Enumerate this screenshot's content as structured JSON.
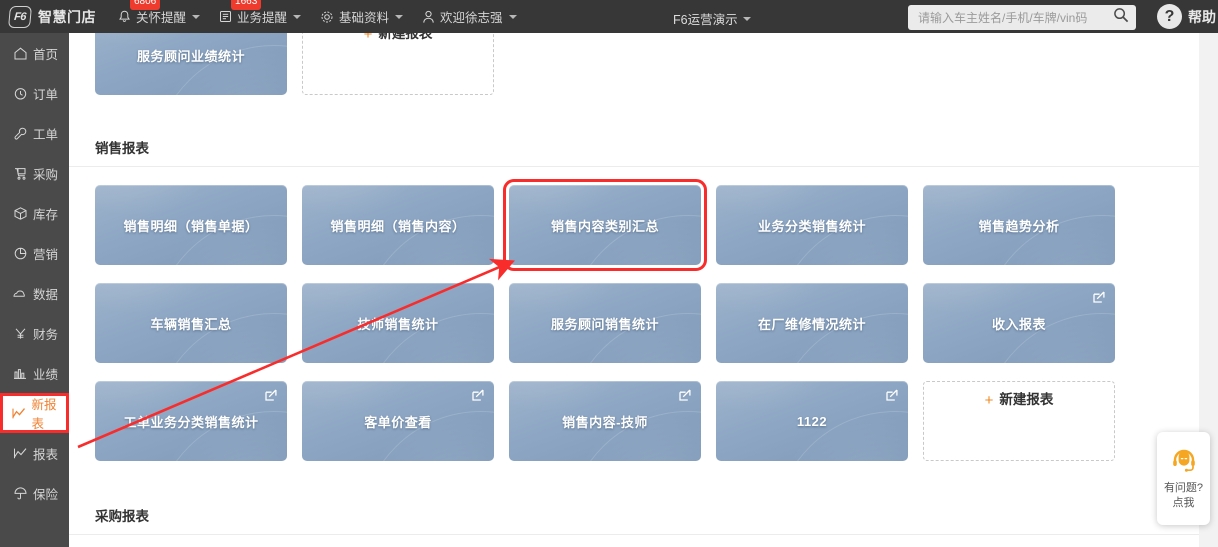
{
  "topbar": {
    "logo_text": "智慧门店",
    "logo_mark": "F6",
    "nav_items": [
      {
        "label": "关怀提醒",
        "icon": "bell-icon",
        "badge": "6806",
        "caret": true
      },
      {
        "label": "业务提醒",
        "icon": "document-icon",
        "badge": "1663",
        "caret": true
      },
      {
        "label": "基础资料",
        "icon": "gear-icon",
        "badge": "",
        "caret": true
      },
      {
        "label": "欢迎徐志强",
        "icon": "user-icon",
        "badge": "",
        "caret": true
      }
    ],
    "tenant": "F6运营演示",
    "search_placeholder": "请输入车主姓名/手机/车牌/vin码",
    "search_value": "",
    "help_label": "帮助",
    "help_icon": "question-mark-icon"
  },
  "sidebar": {
    "items": [
      {
        "label": "首页",
        "icon": "home-icon",
        "active": false
      },
      {
        "label": "订单",
        "icon": "clock-icon",
        "active": false
      },
      {
        "label": "工单",
        "icon": "wrench-icon",
        "active": false
      },
      {
        "label": "采购",
        "icon": "cart-icon",
        "active": false
      },
      {
        "label": "库存",
        "icon": "box-icon",
        "active": false
      },
      {
        "label": "营销",
        "icon": "pie-chart-icon",
        "active": false
      },
      {
        "label": "数据",
        "icon": "cloud-icon",
        "active": false
      },
      {
        "label": "财务",
        "icon": "yuan-icon",
        "active": false
      },
      {
        "label": "业绩",
        "icon": "bar-chart-icon",
        "active": false
      },
      {
        "label": "新报表",
        "icon": "line-chart-icon",
        "active": true
      },
      {
        "label": "报表",
        "icon": "chart-icon",
        "active": false
      },
      {
        "label": "保险",
        "icon": "umbrella-icon",
        "active": false
      }
    ]
  },
  "main": {
    "clipped_section": {
      "cards": [
        {
          "label": "服务顾问业绩统计",
          "editable": false,
          "selected": false
        }
      ],
      "new_report_label": "新建报表",
      "new_report_plus": "+"
    },
    "sections": [
      {
        "title": "销售报表",
        "rows": [
          [
            {
              "label": "销售明细（销售单据）",
              "editable": false,
              "selected": false
            },
            {
              "label": "销售明细（销售内容）",
              "editable": false,
              "selected": false
            },
            {
              "label": "销售内容类别汇总",
              "editable": false,
              "selected": true
            },
            {
              "label": "业务分类销售统计",
              "editable": false,
              "selected": false
            },
            {
              "label": "销售趋势分析",
              "editable": false,
              "selected": false
            }
          ],
          [
            {
              "label": "车辆销售汇总",
              "editable": false,
              "selected": false
            },
            {
              "label": "技师销售统计",
              "editable": false,
              "selected": false
            },
            {
              "label": "服务顾问销售统计",
              "editable": false,
              "selected": false
            },
            {
              "label": "在厂维修情况统计",
              "editable": false,
              "selected": false
            },
            {
              "label": "收入报表",
              "editable": true,
              "selected": false
            }
          ],
          [
            {
              "label": "工单业务分类销售统计",
              "editable": true,
              "selected": false
            },
            {
              "label": "客单价查看",
              "editable": true,
              "selected": false
            },
            {
              "label": "销售内容-技师",
              "editable": true,
              "selected": false
            },
            {
              "label": "1122",
              "editable": true,
              "selected": false
            }
          ]
        ],
        "new_report_label": "新建报表",
        "new_report_plus": "+"
      },
      {
        "title": "采购报表",
        "rows": [],
        "new_report_label": "",
        "new_report_plus": ""
      }
    ]
  },
  "chat_widget": {
    "icon": "headset-agent-icon",
    "line1": "有问题?",
    "line2": "点我"
  },
  "annotations": {
    "arrow_color": "#f92c2c",
    "highlight_color": "#f92c2c",
    "accent_orange": "#f08233"
  }
}
